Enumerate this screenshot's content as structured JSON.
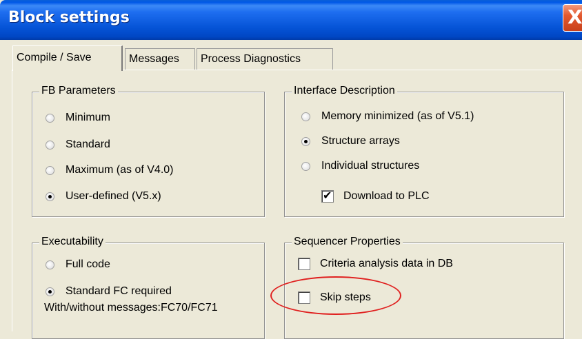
{
  "window": {
    "title": "Block settings",
    "close_label": "X"
  },
  "tabs": [
    {
      "label": "Compile / Save",
      "active": true
    },
    {
      "label": "Messages",
      "active": false
    },
    {
      "label": "Process Diagnostics",
      "active": false
    }
  ],
  "fb_parameters": {
    "title": "FB Parameters",
    "options": [
      {
        "label": "Minimum",
        "selected": false
      },
      {
        "label": "Standard",
        "selected": false
      },
      {
        "label": "Maximum (as of V4.0)",
        "selected": false
      },
      {
        "label": "User-defined (V5.x)",
        "selected": true
      }
    ]
  },
  "interface_description": {
    "title": "Interface Description",
    "options": [
      {
        "label": "Memory minimized (as of V5.1)",
        "selected": false
      },
      {
        "label": "Structure arrays",
        "selected": true
      },
      {
        "label": "Individual structures",
        "selected": false
      }
    ],
    "download": {
      "label": "Download to PLC",
      "checked": true
    }
  },
  "executability": {
    "title": "Executability",
    "options": [
      {
        "label": "Full code",
        "selected": false
      },
      {
        "label": "Standard FC required",
        "selected": true
      }
    ],
    "note": "With/without messages:FC70/FC71"
  },
  "sequencer_properties": {
    "title": "Sequencer Properties",
    "options": [
      {
        "label": "Criteria analysis data in DB",
        "checked": false
      },
      {
        "label": "Skip steps",
        "checked": false
      }
    ]
  },
  "colors": {
    "titlebar": "#0553d6",
    "dialog_bg": "#ece9d8",
    "highlight": "#e0201f"
  }
}
